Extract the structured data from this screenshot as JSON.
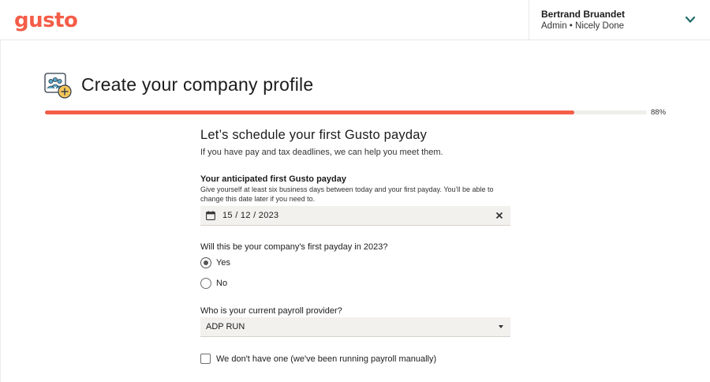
{
  "header": {
    "logo": "gusto",
    "user_name": "Bertrand Bruandet",
    "user_role": "Admin • Nicely Done",
    "menu_icon": "chevron-down-icon"
  },
  "page": {
    "title": "Create your company profile",
    "icon": "company-people-add-icon"
  },
  "progress": {
    "value": 0.88,
    "label": "88%"
  },
  "form": {
    "section_title": "Let’s schedule your first Gusto payday",
    "section_subtitle": "If you have pay and tax deadlines, we can help you meet them.",
    "payday_label": "Your anticipated first Gusto payday",
    "payday_help": "Give yourself at least six business days between today and your first payday. You’ll be able to change this date later if you need to.",
    "payday_value": "15 / 12 / 2023",
    "payday_question": "Will this be your company's first payday in 2023?",
    "payday_options": [
      "Yes",
      "No"
    ],
    "payday_selected": "Yes",
    "provider_label": "Who is your current payroll provider?",
    "provider_value": "ADP RUN",
    "manual_checkbox_label": "We don't have one (we've been running payroll manually)",
    "manual_checked": false
  },
  "colors": {
    "brand": "#f45d48",
    "input_bg": "#f3f1ed",
    "progress_track": "#f0eeea"
  }
}
